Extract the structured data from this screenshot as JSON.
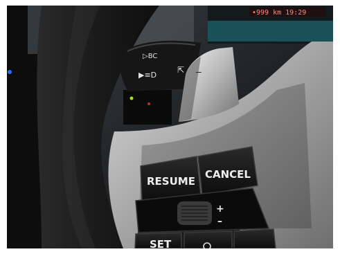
{
  "scene": {
    "subject": "Steering wheel with paddle shifter and cruise-control buttons"
  },
  "stalk": {
    "bc_label": "▷BC",
    "light_label": "▶≡D"
  },
  "paddle": {
    "mark": "–"
  },
  "dashboard": {
    "readout": "•999 km   19:29"
  },
  "buttons": {
    "resume": "RESUME",
    "cancel": "CANCEL",
    "plus": "+",
    "minus": "–",
    "set": "SET"
  },
  "colors": {
    "wheel_leather": "#1f1f1f",
    "spoke_silver": "#bcbcbc",
    "button_black": "#151515",
    "dash_red": "#ff5a4a",
    "ambient_teal": "#1e6d78",
    "led_blue": "#2a6cff"
  }
}
